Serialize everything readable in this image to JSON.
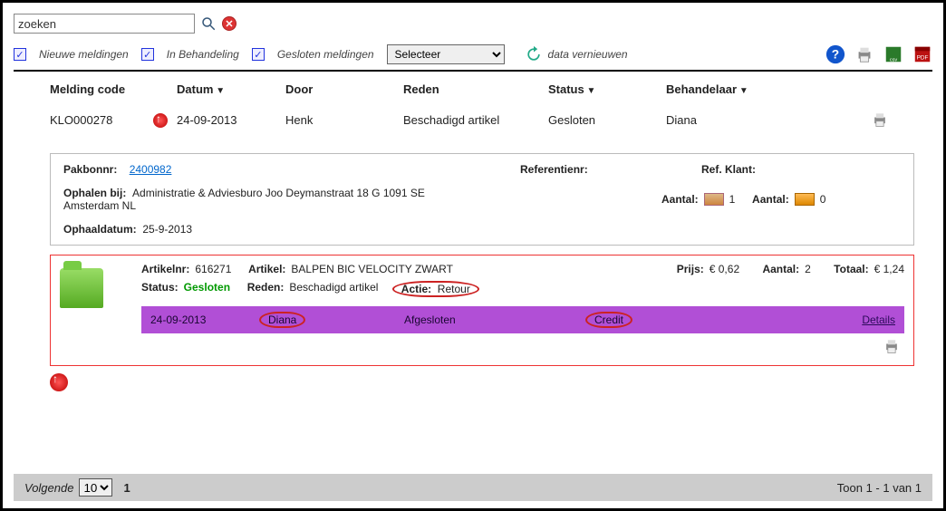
{
  "search": {
    "value": "zoeken"
  },
  "filters": {
    "nieuwe": "Nieuwe meldingen",
    "inbehandeling": "In Behandeling",
    "gesloten": "Gesloten meldingen",
    "select_placeholder": "Selecteer",
    "refresh": "data vernieuwen"
  },
  "columns": {
    "code": "Melding code",
    "datum": "Datum",
    "door": "Door",
    "reden": "Reden",
    "status": "Status",
    "behandelaar": "Behandelaar"
  },
  "row": {
    "code": "KLO000278",
    "datum": "24-09-2013",
    "door": "Henk",
    "reden": "Beschadigd artikel",
    "status": "Gesloten",
    "behandelaar": "Diana"
  },
  "info": {
    "pakbon_label": "Pakbonnr:",
    "pakbon_value": "2400982",
    "referentie_label": "Referentienr:",
    "refklant_label": "Ref. Klant:",
    "ophalen_label": "Ophalen bij:",
    "ophalen_value": "Administratie & Adviesburo Joo Deymanstraat 18 G 1091 SE Amsterdam NL",
    "aantal1_label": "Aantal:",
    "aantal1_value": "1",
    "aantal2_label": "Aantal:",
    "aantal2_value": "0",
    "ophaaldatum_label": "Ophaaldatum:",
    "ophaaldatum_value": "25-9-2013"
  },
  "article": {
    "artnr_label": "Artikelnr:",
    "artnr_value": "616271",
    "artikel_label": "Artikel:",
    "artikel_value": "BALPEN BIC VELOCITY ZWART",
    "prijs_label": "Prijs:",
    "prijs_value": "€ 0,62",
    "aantal_label": "Aantal:",
    "aantal_value": "2",
    "totaal_label": "Totaal:",
    "totaal_value": "€ 1,24",
    "status_label": "Status:",
    "status_value": "Gesloten",
    "reden_label": "Reden:",
    "reden_value": "Beschadigd artikel",
    "actie_label": "Actie:",
    "actie_value": "Retour"
  },
  "bar": {
    "date": "24-09-2013",
    "name": "Diana",
    "status": "Afgesloten",
    "action": "Credit",
    "details": "Details"
  },
  "footer": {
    "volgende": "Volgende",
    "pagesize": "10",
    "page": "1",
    "toon": "Toon 1 - 1 van 1"
  }
}
